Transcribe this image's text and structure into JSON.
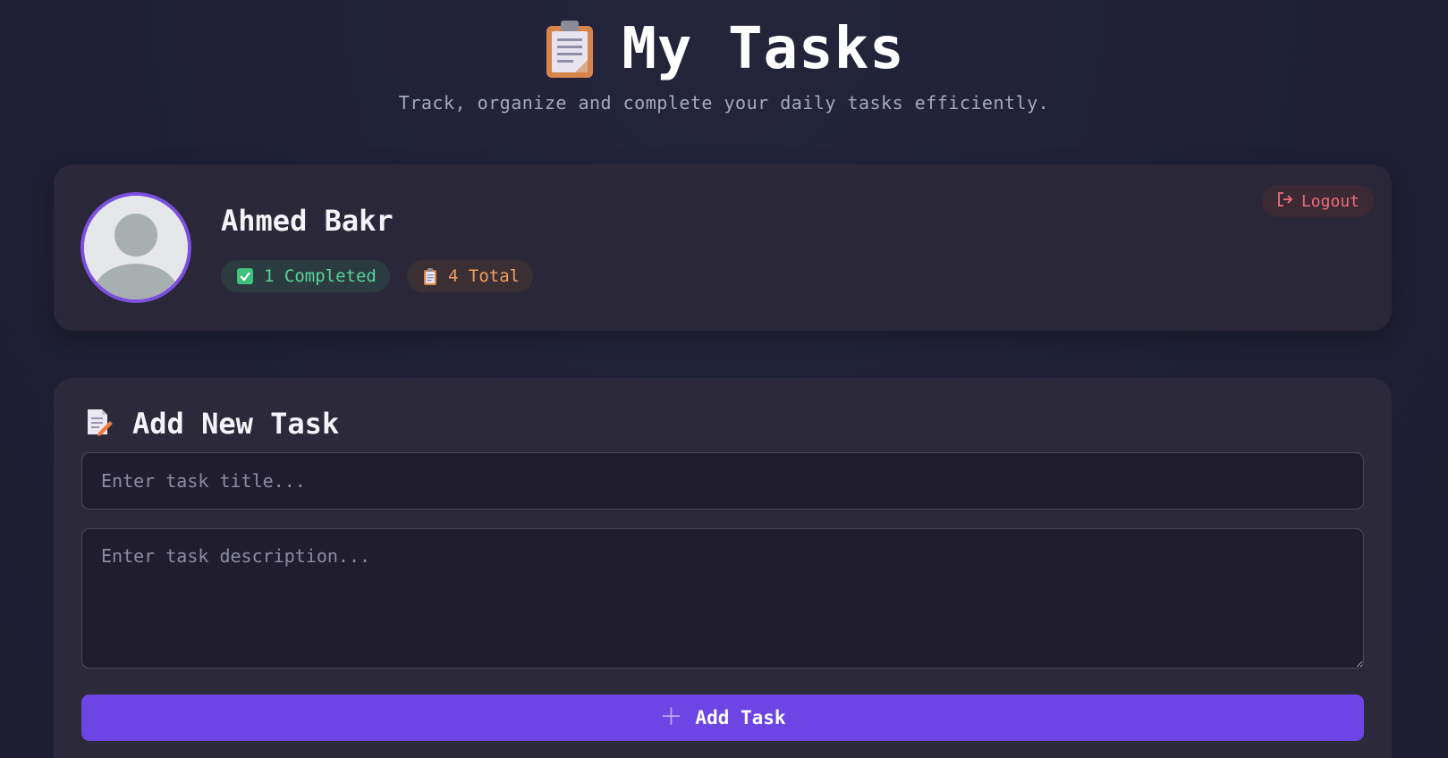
{
  "header": {
    "title": "My Tasks",
    "subtitle": "Track, organize and complete your daily tasks efficiently.",
    "icon": "clipboard-icon"
  },
  "profile": {
    "name": "Ahmed Bakr",
    "avatar_icon": "default-user-avatar",
    "completed_badge": {
      "icon": "check-box-icon",
      "label": "1 Completed",
      "color": "#57d39a"
    },
    "total_badge": {
      "icon": "clipboard-icon",
      "label": "4 Total",
      "color": "#f0a060"
    },
    "logout_label": "Logout",
    "logout_icon": "logout-icon"
  },
  "add_task": {
    "title": "Add New Task",
    "icon": "memo-icon",
    "title_placeholder": "Enter task title...",
    "description_placeholder": "Enter task description...",
    "button_label": "Add Task",
    "button_icon": "plus-icon"
  },
  "colors": {
    "accent": "#6c45e4",
    "avatar_ring": "#7b4fe0",
    "background": "#1f2035",
    "card": "#2a2838",
    "logout": "#f06c7a"
  }
}
